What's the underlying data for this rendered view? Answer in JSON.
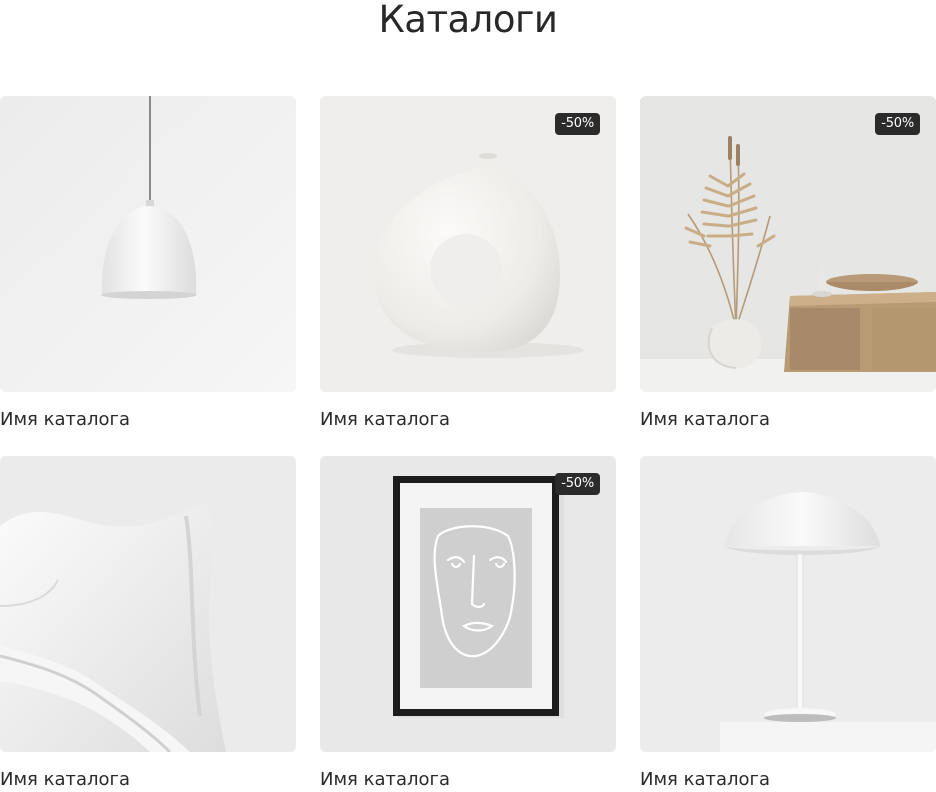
{
  "page": {
    "title": "Каталоги"
  },
  "catalogs": [
    {
      "name": "Имя каталога",
      "badge": "",
      "image": "pendant-lamp-image"
    },
    {
      "name": "Имя каталога",
      "badge": "-50%",
      "image": "donut-vase-image"
    },
    {
      "name": "Имя каталога",
      "badge": "-50%",
      "image": "dried-plant-shelf-image"
    },
    {
      "name": "Имя каталога",
      "badge": "",
      "image": "white-chair-image"
    },
    {
      "name": "Имя каталога",
      "badge": "-50%",
      "image": "framed-face-art-image"
    },
    {
      "name": "Имя каталога",
      "badge": "",
      "image": "table-lamp-image"
    }
  ],
  "colors": {
    "badge_background": "#2b2b2b",
    "badge_text": "#ffffff",
    "text": "#2a2a2a"
  }
}
